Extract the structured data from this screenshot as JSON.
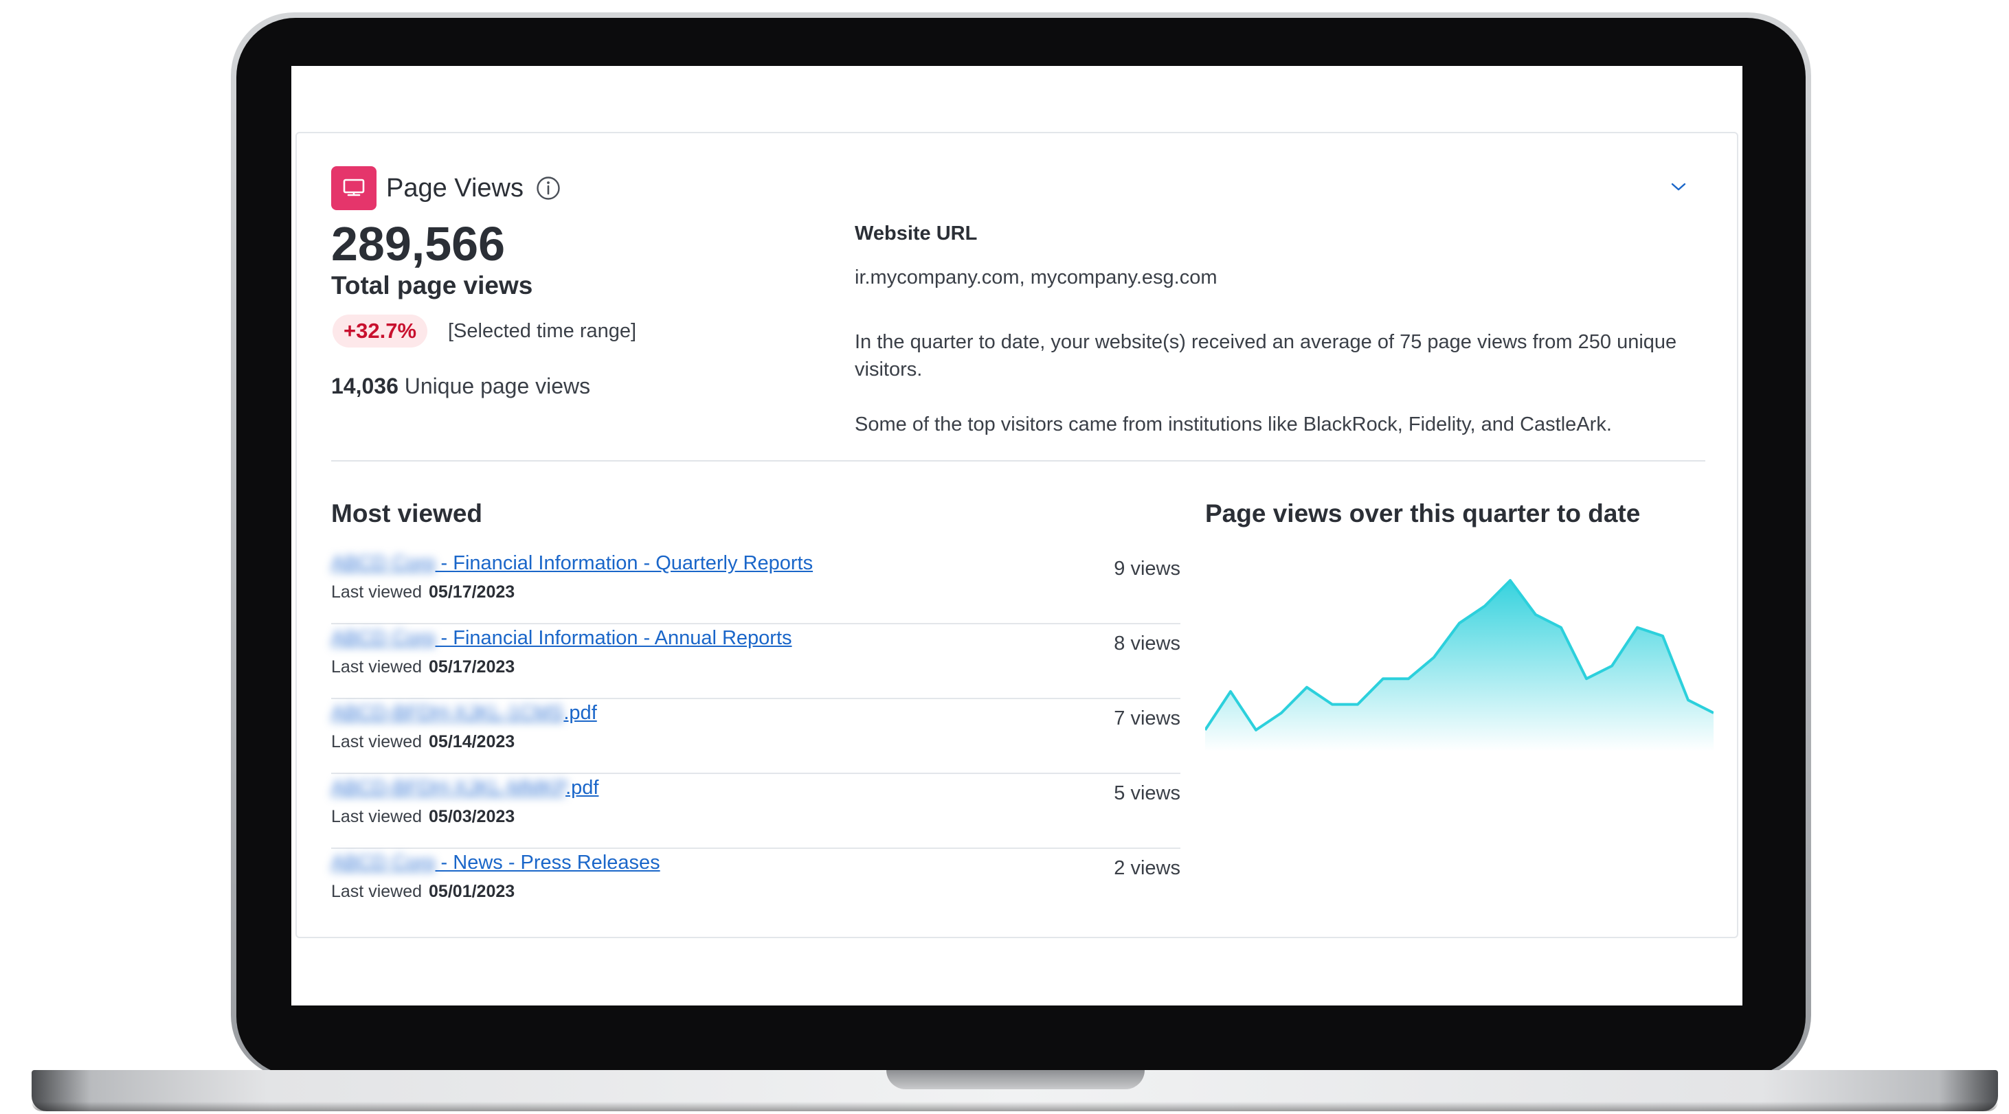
{
  "header": {
    "title": "Page Views",
    "icon": "presentation-screen-icon",
    "accent_color": "#e5356b"
  },
  "stats": {
    "total_page_views": "289,566",
    "total_label": "Total page views",
    "change": "+32.7%",
    "change_color": "#c8102e",
    "range_label": "[Selected time range]",
    "unique_count": "14,036",
    "unique_label": "Unique page views"
  },
  "website": {
    "heading": "Website URL",
    "urls": "ir.mycompany.com, mycompany.esg.com",
    "summary": "In the quarter to date, your website(s) received an average of 75 page views from 250 unique visitors.",
    "top_visitors": "Some of the top visitors came from institutions like BlackRock, Fidelity, and CastleArk."
  },
  "most_viewed": {
    "heading": "Most viewed",
    "last_viewed_label": "Last viewed",
    "items": [
      {
        "title_blurred": "ABCD Corp",
        "title": " - Financial Information - Quarterly Reports",
        "date": "05/17/2023",
        "views": "9 views"
      },
      {
        "title_blurred": "ABCD Corp",
        "title": " - Financial Information - Annual Reports",
        "date": "05/17/2023",
        "views": "8 views"
      },
      {
        "title_blurred": "ABCD-BFDH-XJKL-1CMS",
        "title": ".pdf",
        "date": "05/14/2023",
        "views": "7 views"
      },
      {
        "title_blurred": "ABCD-BFDH-XJKL-MMKP",
        "title": ".pdf",
        "date": "05/03/2023",
        "views": "5 views"
      },
      {
        "title_blurred": "ABCD Corp",
        "title": " - News - Press Releases",
        "date": "05/01/2023",
        "views": "2 views"
      }
    ]
  },
  "chart_data": {
    "type": "area",
    "title": "Page views over this quarter to date",
    "xlabel": "",
    "ylabel": "",
    "grid": false,
    "color": "#2cd0dc",
    "x": [
      0,
      1,
      2,
      3,
      4,
      5,
      6,
      7,
      8,
      9,
      10,
      11,
      12,
      13,
      14,
      15,
      16,
      17,
      18,
      19,
      20
    ],
    "values": [
      10,
      28,
      10,
      18,
      30,
      22,
      22,
      34,
      34,
      44,
      60,
      68,
      80,
      64,
      58,
      34,
      40,
      58,
      54,
      24,
      18
    ],
    "ylim": [
      0,
      90
    ]
  }
}
